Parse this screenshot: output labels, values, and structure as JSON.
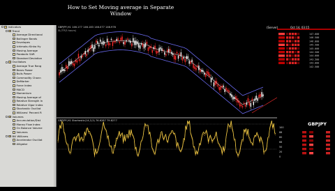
{
  "window": {
    "title": "How to Set Moving average in Separate Window"
  },
  "chart_header": {
    "symbol_line": "GBPJPY,H1  146.177 146.183 146.077 146.976",
    "line2": "SL/TP(3 hours)",
    "indicator_line": "GBPJPY,H1  Stochastic(14,3,3) 76.6287 79.8277"
  },
  "right_panel": {
    "clock_label": "(Server)",
    "clock_time": "Oct 14, 03:15",
    "price_levels": [
      "147.000",
      "146.500",
      "146.000",
      "145.500",
      "145.000",
      "144.500",
      "144.000",
      "143.500",
      "143.000",
      "142.500"
    ],
    "levels_small": [
      "100",
      "88",
      "80",
      "68",
      "50",
      "20",
      "0"
    ],
    "symbol_badge": "GBPJPY"
  },
  "navigator": {
    "items": [
      {
        "label": "Indicators",
        "level": 0,
        "folder": true,
        "expanded": true
      },
      {
        "label": "Trend",
        "level": 1,
        "folder": true,
        "expanded": true
      },
      {
        "label": "Average Directional",
        "level": 2
      },
      {
        "label": "Bollinger Bands",
        "level": 2
      },
      {
        "label": "Envelopes",
        "level": 2
      },
      {
        "label": "Ichimoku Kinko Hy",
        "level": 2
      },
      {
        "label": "Moving Average",
        "level": 2
      },
      {
        "label": "Parabolic SAR",
        "level": 2
      },
      {
        "label": "Standard Deviation",
        "level": 2
      },
      {
        "label": "Oscillators",
        "level": 1,
        "folder": true,
        "expanded": true
      },
      {
        "label": "Average True Rang",
        "level": 2
      },
      {
        "label": "Bears Power",
        "level": 2
      },
      {
        "label": "Bulls Power",
        "level": 2
      },
      {
        "label": "Commodity Chann",
        "level": 2
      },
      {
        "label": "DeMarker",
        "level": 2
      },
      {
        "label": "Force Index",
        "level": 2
      },
      {
        "label": "MACD",
        "level": 2
      },
      {
        "label": "Momentum",
        "level": 2
      },
      {
        "label": "Moving Average of",
        "level": 2
      },
      {
        "label": "Relative Strength In",
        "level": 2
      },
      {
        "label": "Relative Vigor Index",
        "level": 2
      },
      {
        "label": "Stochastic Oscillat",
        "level": 2
      },
      {
        "label": "Williams' Percent R",
        "level": 2
      },
      {
        "label": "Volumes",
        "level": 1,
        "folder": true,
        "expanded": true
      },
      {
        "label": "Accumulation/Dist",
        "level": 2
      },
      {
        "label": "Money Flow Index",
        "level": 2
      },
      {
        "label": "On Balance Volume",
        "level": 2
      },
      {
        "label": "Volumes",
        "level": 2
      },
      {
        "label": "Bill Williams",
        "level": 1,
        "folder": true,
        "expanded": true
      },
      {
        "label": "Accelerator Oscillat",
        "level": 2
      },
      {
        "label": "Alligator",
        "level": 2
      }
    ]
  },
  "colors": {
    "bull": "#ffffff",
    "bear": "#ff2a2a",
    "ma": "#ffffff",
    "envelope": "#6a6af0",
    "stoch": "#ffd84a",
    "trend_line": "#ff3030"
  }
}
